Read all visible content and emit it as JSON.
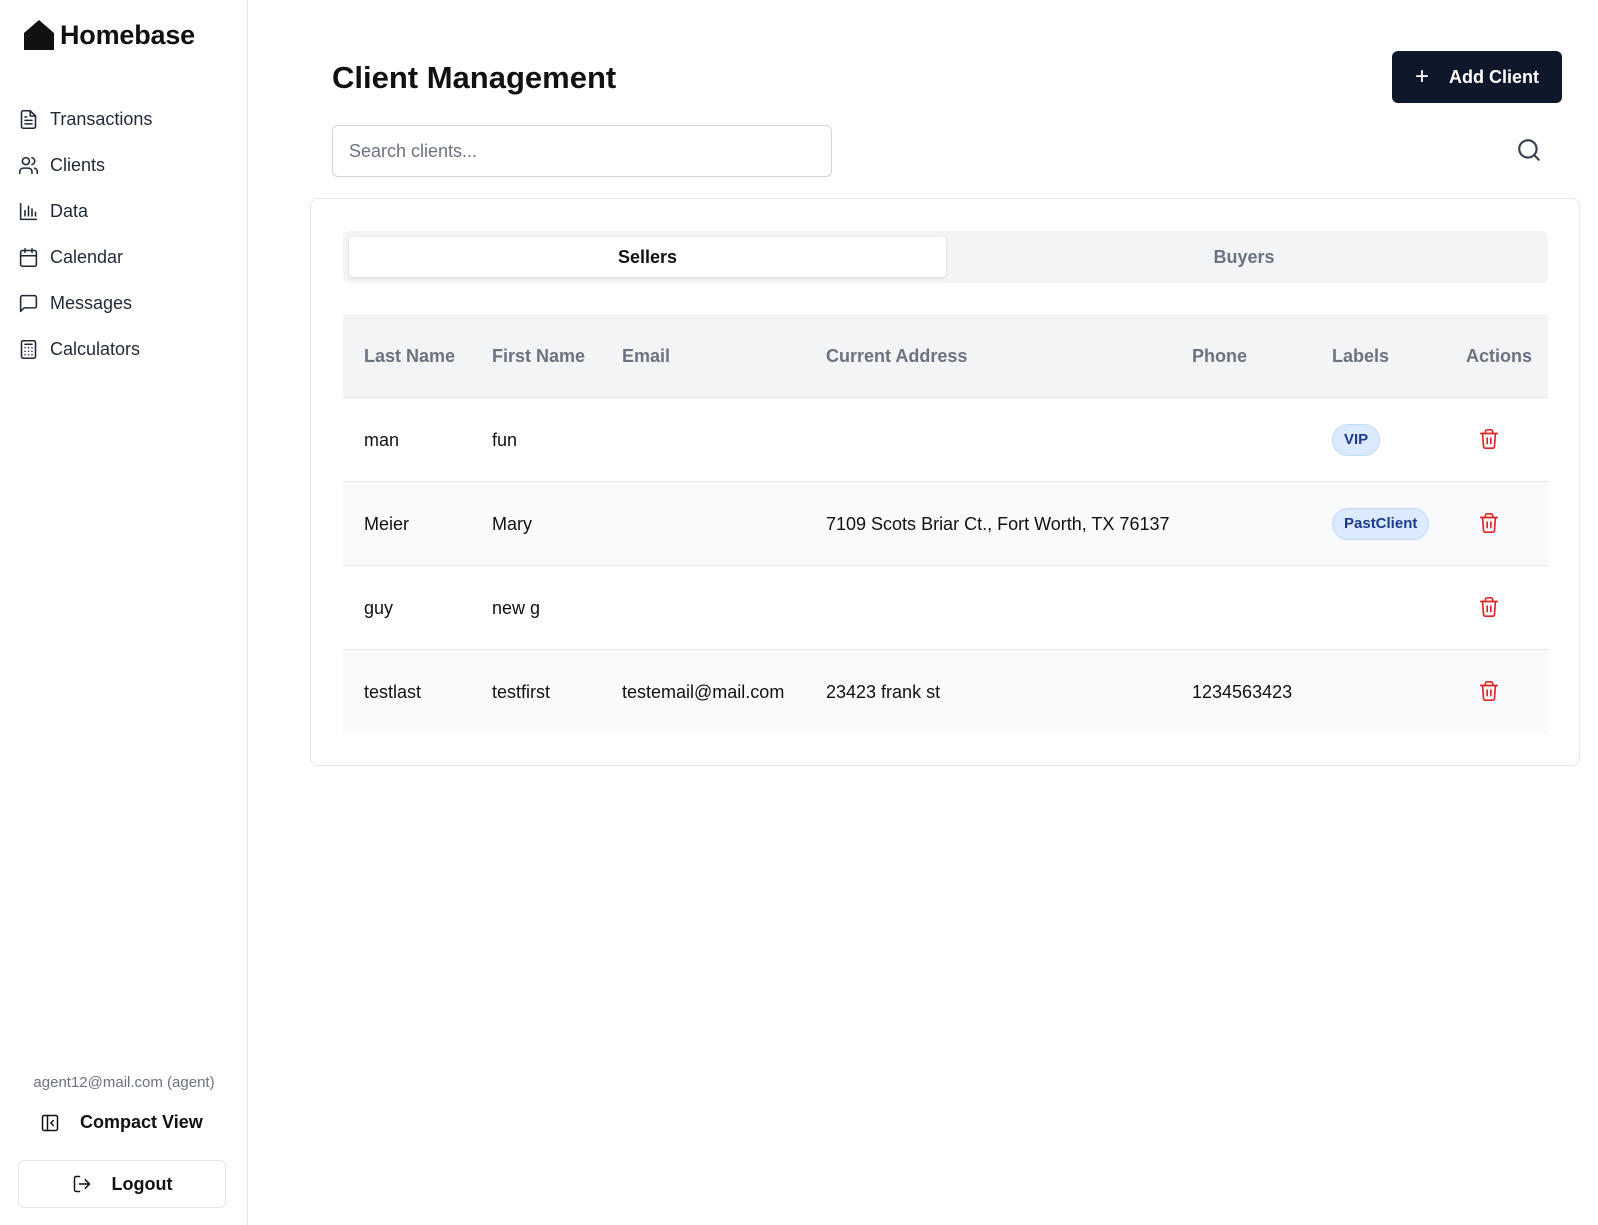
{
  "app": {
    "name": "Homebase"
  },
  "sidebar": {
    "items": [
      {
        "label": "Transactions",
        "icon": "file-text-icon"
      },
      {
        "label": "Clients",
        "icon": "users-icon"
      },
      {
        "label": "Data",
        "icon": "bar-chart-icon"
      },
      {
        "label": "Calendar",
        "icon": "calendar-icon"
      },
      {
        "label": "Messages",
        "icon": "message-square-icon"
      },
      {
        "label": "Calculators",
        "icon": "calculator-icon"
      }
    ],
    "account": "agent12@mail.com (agent)",
    "compact_label": "Compact View",
    "logout_label": "Logout"
  },
  "main": {
    "title": "Client Management",
    "add_button_label": "Add Client",
    "search_placeholder": "Search clients...",
    "tabs": [
      {
        "label": "Sellers",
        "active": true
      },
      {
        "label": "Buyers",
        "active": false
      }
    ],
    "columns": [
      "Last Name",
      "First Name",
      "Email",
      "Current Address",
      "Phone",
      "Labels",
      "Actions"
    ],
    "rows": [
      {
        "last": "man",
        "first": "fun",
        "email": "",
        "address": "",
        "phone": "",
        "label": "VIP"
      },
      {
        "last": "Meier",
        "first": "Mary",
        "email": "",
        "address": "7109 Scots Briar Ct., Fort Worth, TX 76137",
        "phone": "",
        "label": "PastClient"
      },
      {
        "last": "guy",
        "first": "new g",
        "email": "",
        "address": "",
        "phone": "",
        "label": ""
      },
      {
        "last": "testlast",
        "first": "testfirst",
        "email": "testemail@mail.com",
        "address": "23423 frank st",
        "phone": "1234563423",
        "label": ""
      }
    ]
  },
  "colors": {
    "primary_button": "#0f172a",
    "badge_bg": "#dbeafe",
    "badge_text": "#1e3a8a",
    "delete": "#dc2626"
  }
}
